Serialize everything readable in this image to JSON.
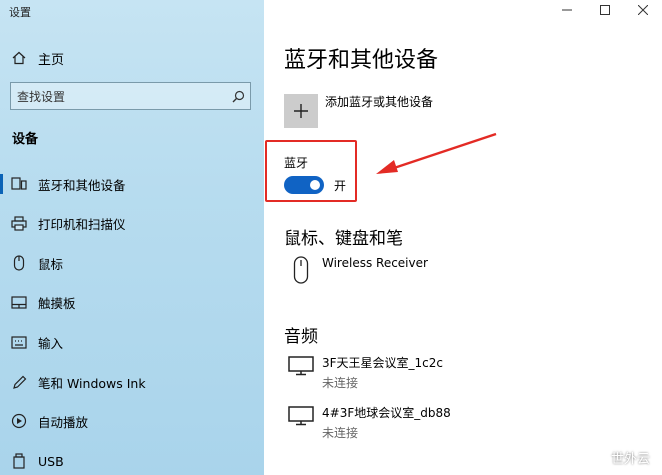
{
  "window": {
    "title": "设置"
  },
  "sidebar": {
    "home_label": "主页",
    "search_placeholder": "查找设置",
    "section_title": "设备",
    "items": [
      {
        "label": "蓝牙和其他设备",
        "icon": "bluetooth-devices-icon",
        "active": true
      },
      {
        "label": "打印机和扫描仪",
        "icon": "printer-icon"
      },
      {
        "label": "鼠标",
        "icon": "mouse-icon"
      },
      {
        "label": "触摸板",
        "icon": "touchpad-icon"
      },
      {
        "label": "输入",
        "icon": "keyboard-icon"
      },
      {
        "label": "笔和 Windows Ink",
        "icon": "pen-icon"
      },
      {
        "label": "自动播放",
        "icon": "autoplay-icon"
      },
      {
        "label": "USB",
        "icon": "usb-icon"
      }
    ]
  },
  "main": {
    "title": "蓝牙和其他设备",
    "add_device_label": "添加蓝牙或其他设备",
    "bluetooth": {
      "label": "蓝牙",
      "state_label": "开",
      "on": true
    },
    "mouse_section": {
      "heading": "鼠标、键盘和笔",
      "devices": [
        {
          "name": "Wireless Receiver",
          "icon": "mouse-device-icon"
        }
      ]
    },
    "audio_section": {
      "heading": "音频",
      "devices": [
        {
          "name": "3F天王星会议室_1c2c",
          "status": "未连接",
          "icon": "monitor-icon"
        },
        {
          "name": "4#3F地球会议室_db88",
          "status": "未连接",
          "icon": "monitor-icon"
        }
      ]
    }
  },
  "colors": {
    "accent": "#1063c4",
    "highlight": "#e32b25",
    "sidebar_bg": "#b7dcef"
  },
  "watermark": {
    "text": "世外云"
  }
}
